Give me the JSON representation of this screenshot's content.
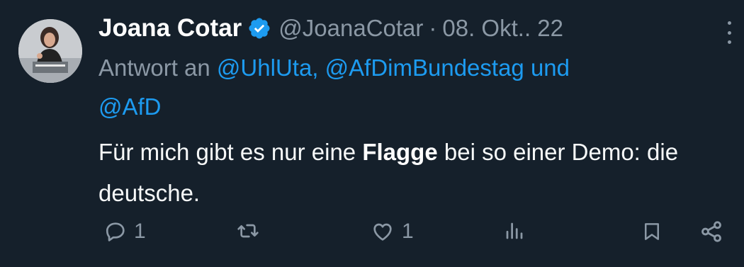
{
  "author": {
    "name": "Joana Cotar",
    "handle": "@JoanaCotar",
    "date": "08. Okt.. 22",
    "avatar_icon": "profile-photo",
    "verified_color": "#1d9bf0"
  },
  "separator": "·",
  "reply": {
    "prefix": "Antwort an",
    "mention1": "@UhlUta,",
    "mention2": "@AfDimBundestag",
    "conjunction": "und",
    "mention3": "@AfD"
  },
  "body": {
    "text_before": "Für mich gibt es nur eine",
    "bold": "Flagge",
    "text_after": "bei so einer Demo: die deutsche."
  },
  "actions": {
    "reply_count": "1",
    "retweet_count": "",
    "like_count": "1"
  },
  "colors": {
    "background": "#15202b",
    "text_primary": "#f7f9f9",
    "text_secondary": "#8b98a5",
    "accent": "#1d9bf0"
  }
}
